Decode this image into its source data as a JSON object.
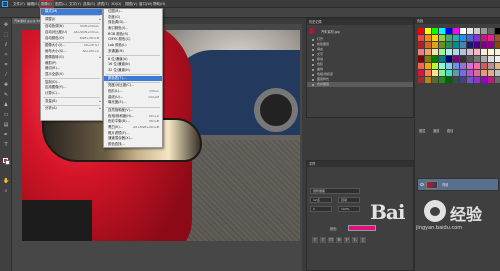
{
  "menubar": {
    "logo": "Ps",
    "items": [
      "文件(F)",
      "编辑(E)",
      "图像(I)",
      "图层(L)",
      "文字(Y)",
      "选择(S)",
      "滤镜(T)",
      "3D(D)",
      "视图(V)",
      "窗口(W)",
      "帮助(H)"
    ],
    "highlighted_index": 2
  },
  "document_tab": "汽车素材.jpg @ 50% (RGB/8#)",
  "image_menu": {
    "rows": [
      {
        "label": "模式(M)",
        "shortcut": "",
        "arrow": true,
        "selected": true
      },
      {
        "sep": true
      },
      {
        "label": "调整(J)",
        "shortcut": "",
        "arrow": true
      },
      {
        "sep": true
      },
      {
        "label": "自动色调(N)",
        "shortcut": "Shift+Ctrl+L"
      },
      {
        "label": "自动对比度(U)",
        "shortcut": "Alt+Shift+Ctrl+L"
      },
      {
        "label": "自动颜色(O)",
        "shortcut": "Shift+Ctrl+B"
      },
      {
        "sep": true
      },
      {
        "label": "图像大小(I)...",
        "shortcut": "Alt+Ctrl+I"
      },
      {
        "label": "画布大小(S)...",
        "shortcut": "Alt+Ctrl+C"
      },
      {
        "label": "图像旋转(G)",
        "shortcut": "",
        "arrow": true
      },
      {
        "label": "裁剪(P)",
        "shortcut": ""
      },
      {
        "label": "裁切(R)...",
        "shortcut": ""
      },
      {
        "label": "显示全部(V)",
        "shortcut": ""
      },
      {
        "sep": true
      },
      {
        "label": "复制(D)...",
        "shortcut": ""
      },
      {
        "label": "应用图像(Y)...",
        "shortcut": ""
      },
      {
        "label": "计算(C)...",
        "shortcut": ""
      },
      {
        "sep": true
      },
      {
        "label": "变量(B)",
        "shortcut": "",
        "arrow": true
      },
      {
        "sep": true
      },
      {
        "label": "分析(A)",
        "shortcut": "",
        "arrow": true
      }
    ]
  },
  "mode_submenu": {
    "rows": [
      {
        "label": "位图(B)...",
        "shortcut": ""
      },
      {
        "label": "灰度(G)",
        "shortcut": ""
      },
      {
        "label": "双色调(D)...",
        "shortcut": ""
      },
      {
        "label": "索引颜色(I)...",
        "shortcut": ""
      },
      {
        "label": "RGB 颜色(R)",
        "shortcut": ""
      },
      {
        "label": "CMYK 颜色(C)",
        "shortcut": ""
      },
      {
        "label": "Lab 颜色(L)",
        "shortcut": ""
      },
      {
        "label": "多通道(M)",
        "shortcut": ""
      },
      {
        "sep": true
      },
      {
        "label": "8 位/通道(A)",
        "shortcut": ""
      },
      {
        "label": "16 位/通道(N)",
        "shortcut": ""
      },
      {
        "label": "32 位/通道(H)",
        "shortcut": ""
      },
      {
        "sep": true
      },
      {
        "label": "颜色表(T)...",
        "shortcut": "",
        "selected": true
      },
      {
        "sep": true
      },
      {
        "label": "亮度/对比度(C)...",
        "shortcut": ""
      },
      {
        "label": "色阶(L)...",
        "shortcut": "Ctrl+L"
      },
      {
        "label": "曲线(U)...",
        "shortcut": "Ctrl+M"
      },
      {
        "label": "曝光度(E)...",
        "shortcut": ""
      },
      {
        "sep": true
      },
      {
        "label": "自然饱和度(V)...",
        "shortcut": ""
      },
      {
        "label": "色相/饱和度(H)...",
        "shortcut": "Ctrl+U"
      },
      {
        "label": "色彩平衡(B)...",
        "shortcut": "Ctrl+B"
      },
      {
        "label": "黑白(K)...",
        "shortcut": "Alt+Shift+Ctrl+B"
      },
      {
        "label": "照片滤镜(F)...",
        "shortcut": ""
      },
      {
        "label": "通道混合器(X)...",
        "shortcut": ""
      },
      {
        "label": "颜色查找...",
        "shortcut": ""
      }
    ]
  },
  "history_panel": {
    "title": "历史记录",
    "snapshot": "汽车素材.jpg",
    "items": [
      "打开",
      "新建图层",
      "填充",
      "文字",
      "移动",
      "色阶",
      "曲线",
      "色相/饱和度",
      "图层样式",
      "合并图层"
    ]
  },
  "character_panel": {
    "title": "字符",
    "font": "微软雅黑",
    "size": "12点",
    "leading": "自动",
    "tracking": "0",
    "scale": "100%",
    "color_label": "颜色:",
    "color": "#e0117f"
  },
  "swatches_panel": {
    "title": "色板"
  },
  "layers_panel": {
    "tabs": [
      "图层",
      "通道",
      "路径"
    ],
    "layers": [
      {
        "name": "背景",
        "selected": true
      }
    ]
  },
  "watermark": {
    "text_left": "Bai",
    "text_right": "经验",
    "url": "jingyan.baidu.com"
  },
  "colors": {
    "accent": "#31a8ff",
    "selection": "#3e7bd6",
    "highlight_box": "#e01b24",
    "foreground": "#e0117f"
  }
}
